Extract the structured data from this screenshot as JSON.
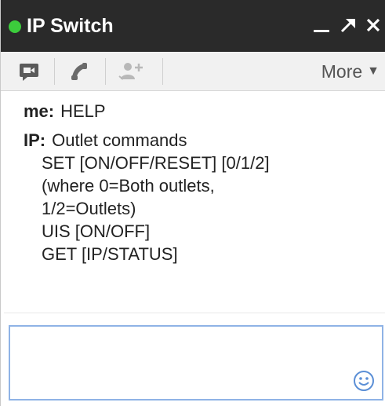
{
  "window": {
    "title": "IP Switch",
    "status_color": "#3ccc3c",
    "controls": {
      "minimize_icon": "minimize-icon",
      "popout_icon": "popout-arrow-icon",
      "close_icon": "close-icon"
    }
  },
  "toolbar": {
    "video_icon": "video-chat-icon",
    "call_icon": "phone-icon",
    "add_people_icon": "add-person-icon",
    "more_label": "More",
    "more_icon": "caret-down-icon"
  },
  "messages": [
    {
      "sender": "me:",
      "lines": [
        "HELP"
      ]
    },
    {
      "sender": "IP:",
      "first_line": "Outlet commands",
      "lines": [
        "SET [ON/OFF/RESET] [0/1/2]",
        "(where 0=Both outlets,",
        "1/2=Outlets)",
        "UIS [ON/OFF]",
        "GET [IP/STATUS]"
      ]
    }
  ],
  "compose": {
    "value": "",
    "emoji_icon": "smiley-icon",
    "border_color": "#8fb3e6"
  }
}
